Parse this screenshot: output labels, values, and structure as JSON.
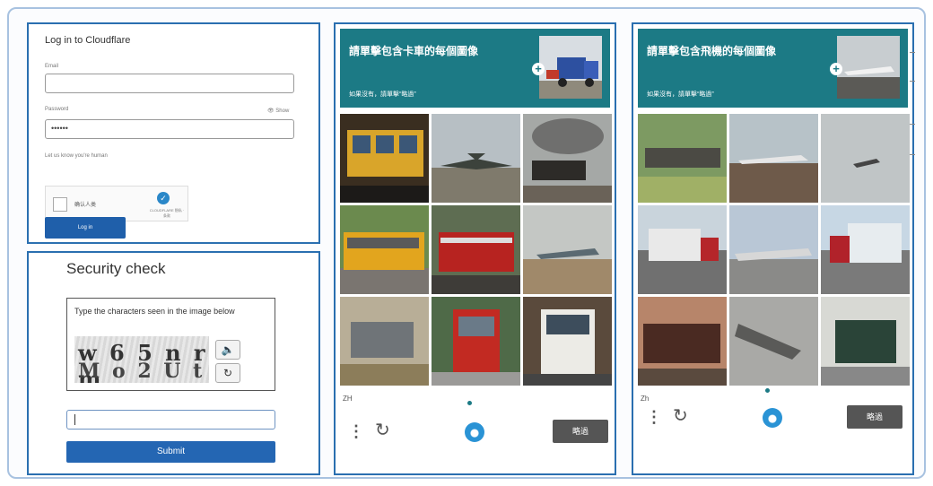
{
  "login": {
    "title": "Log in to Cloudflare",
    "email_label": "Email",
    "email_value": "",
    "password_label": "Password",
    "show_label": "👁 Show",
    "password_value": "••••••",
    "human_label": "Let us know you're human",
    "checkbox_label": "确认人类",
    "turnstile_text": "CLOUDFLARE 隐私 · 条款",
    "login_button": "Log in"
  },
  "security": {
    "title": "Security check",
    "instructions": "Type the characters seen in the image below",
    "captcha_line1": "w 6 5 n r m",
    "captcha_line2": "M o 2 U t w",
    "audio_icon": "🔈",
    "refresh_icon": "↻",
    "input_value": "",
    "submit_label": "Submit"
  },
  "recaptcha_1": {
    "prompt": "請單擊包含卡車的每個圖像",
    "hint": "如果沒有，請單擊“略過”",
    "language": "ZH",
    "skip_label": "略過",
    "tiles": [
      "train",
      "jet",
      "steam-train",
      "bus",
      "fire-truck",
      "fighter-jet",
      "dump-truck",
      "fire-truck-front",
      "truck-front"
    ]
  },
  "recaptcha_2": {
    "prompt": "請單擊包含飛機的每個圖像",
    "hint": "如果沒有，請單擊“略過”",
    "language": "Zh",
    "skip_label": "略過",
    "tiles": [
      "train",
      "plane-on-tarmac",
      "plane-landing",
      "truck-side",
      "plane-ground",
      "truck-red",
      "steam-locomotive",
      "old-plane-wreck",
      "truck-green"
    ]
  }
}
